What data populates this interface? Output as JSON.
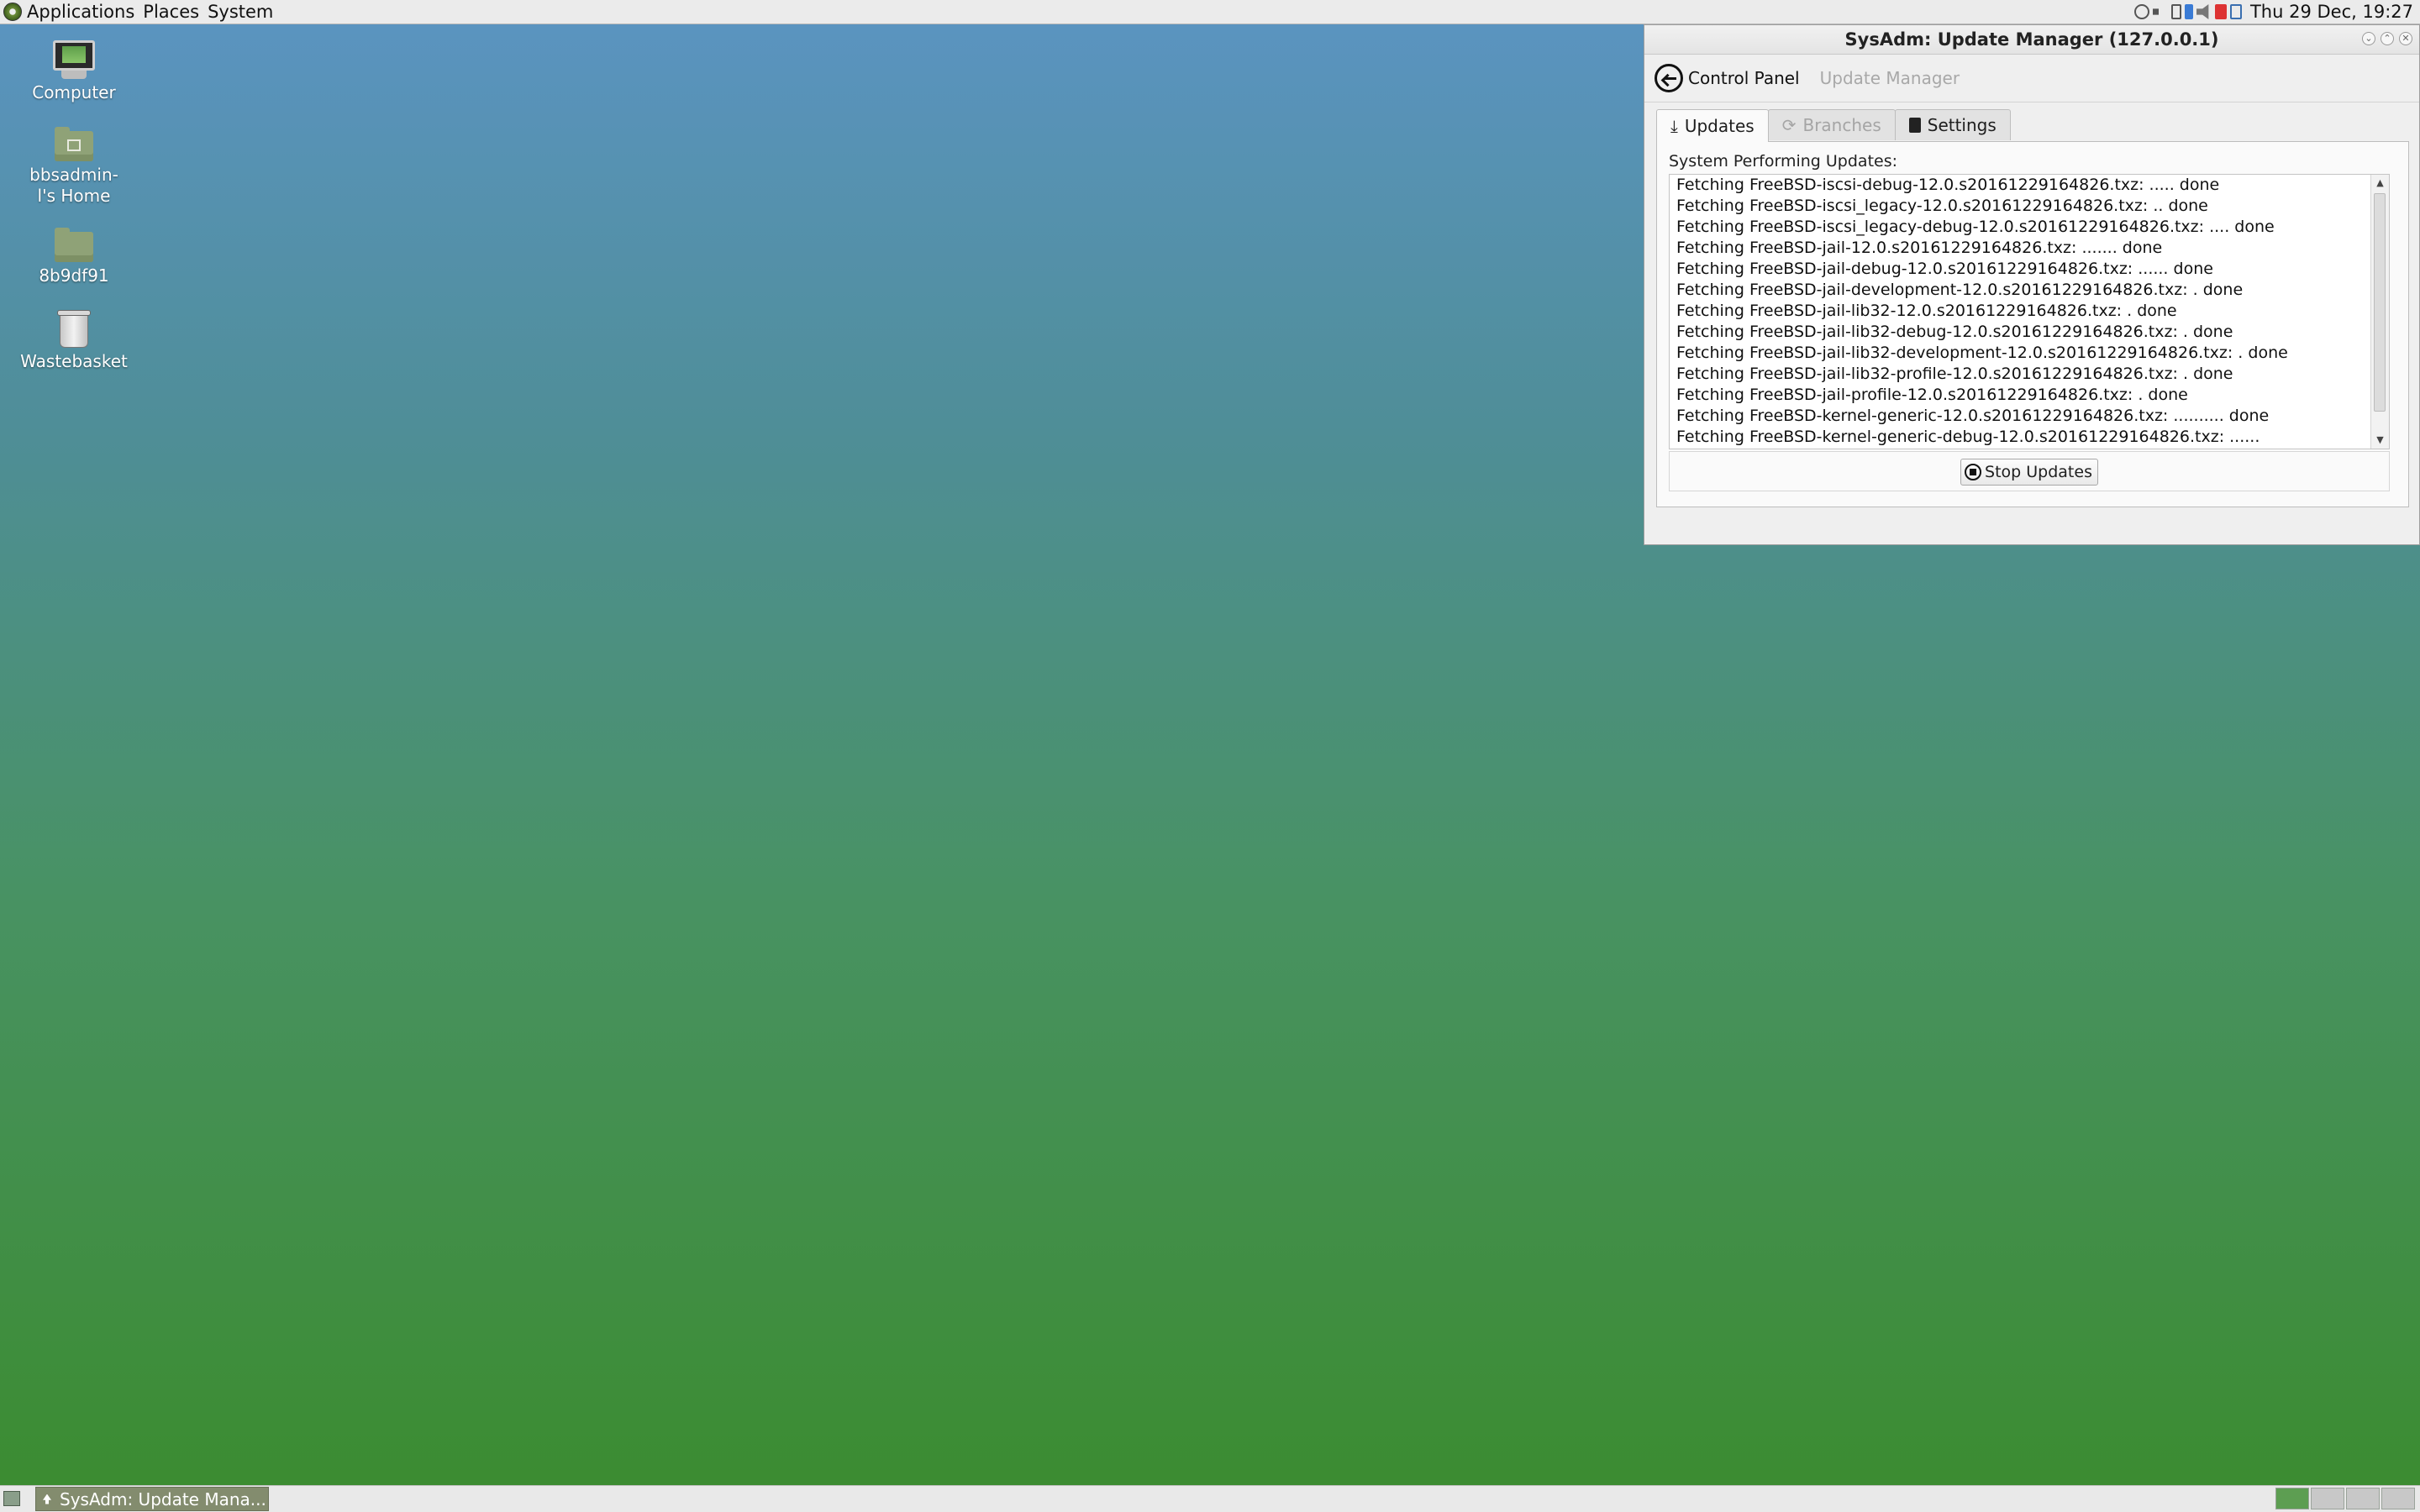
{
  "top_panel": {
    "menus": [
      "Applications",
      "Places",
      "System"
    ],
    "tray_icons": [
      "network-icon",
      "volume-icon",
      "battery-icon",
      "update-icon",
      "speaker-icon",
      "alert-icon",
      "clipboard-icon"
    ],
    "clock": "Thu 29 Dec, 19:27"
  },
  "desktop": {
    "icons": [
      {
        "label": "Computer",
        "icon": "computer-icon"
      },
      {
        "label": "bbsadmin-l's Home",
        "icon": "home-folder-icon"
      },
      {
        "label": "8b9df91",
        "icon": "folder-icon"
      },
      {
        "label": "Wastebasket",
        "icon": "trash-icon"
      }
    ]
  },
  "window": {
    "title": "SysAdm: Update Manager (127.0.0.1)",
    "nav": {
      "back_label": "Control Panel",
      "current": "Update Manager"
    },
    "tabs": [
      {
        "label": "Updates",
        "icon": "download-icon",
        "state": "active"
      },
      {
        "label": "Branches",
        "icon": "refresh-icon",
        "state": "disabled"
      },
      {
        "label": "Settings",
        "icon": "settings-icon",
        "state": "normal"
      }
    ],
    "status_label": "System Performing Updates:",
    "log_lines": [
      "Fetching FreeBSD-iscsi-debug-12.0.s20161229164826.txz: ..... done",
      "Fetching FreeBSD-iscsi_legacy-12.0.s20161229164826.txz: .. done",
      "Fetching FreeBSD-iscsi_legacy-debug-12.0.s20161229164826.txz: .... done",
      "Fetching FreeBSD-jail-12.0.s20161229164826.txz: ....... done",
      "Fetching FreeBSD-jail-debug-12.0.s20161229164826.txz: ...... done",
      "Fetching FreeBSD-jail-development-12.0.s20161229164826.txz: . done",
      "Fetching FreeBSD-jail-lib32-12.0.s20161229164826.txz: . done",
      "Fetching FreeBSD-jail-lib32-debug-12.0.s20161229164826.txz: . done",
      "Fetching FreeBSD-jail-lib32-development-12.0.s20161229164826.txz: . done",
      "Fetching FreeBSD-jail-lib32-profile-12.0.s20161229164826.txz: . done",
      "Fetching FreeBSD-jail-profile-12.0.s20161229164826.txz: . done",
      "Fetching FreeBSD-kernel-generic-12.0.s20161229164826.txz: .......... done",
      "Fetching FreeBSD-kernel-generic-debug-12.0.s20161229164826.txz: ......"
    ],
    "stop_button_label": "Stop Updates"
  },
  "taskbar": {
    "task_label": "SysAdm: Update Mana...",
    "workspaces": 4,
    "active_workspace": 1
  }
}
